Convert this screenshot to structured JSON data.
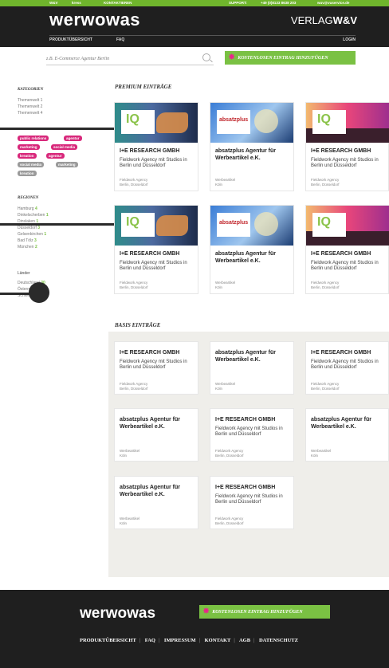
{
  "topbar": {
    "logo": "W&V",
    "partner": "kress",
    "contact": "KONTAKTIEREN",
    "support_label": "SUPPORT:",
    "phone": "+49 (0)8133 8638 203",
    "email": "wuv@vuservice.de"
  },
  "header": {
    "brand": "werwowas",
    "verlag_prefix": "VERLAG",
    "verlag_suffix": "W&V",
    "nav": [
      "PRODUKTÜBERSICHT",
      "FAQ"
    ],
    "login": "LOGIN"
  },
  "search": {
    "placeholder": "z.B. E-Commerce Agentur Berlin",
    "cta_label": "KOSTENLOSEN EINTRAG HINZUFÜGEN"
  },
  "sidebar": {
    "categories_heading": "KATEGORIEN",
    "categories": [
      "Themenwelt 1",
      "Themenwelt 2",
      "Themenwelt 4"
    ],
    "tags": [
      {
        "label": "public relations",
        "style": "pink"
      },
      {
        "label": "agentur",
        "style": "pink"
      },
      {
        "label": "marketing",
        "style": "pink"
      },
      {
        "label": "social media",
        "style": "pink"
      },
      {
        "label": "kreation",
        "style": "pink"
      },
      {
        "label": "agentur",
        "style": "pink"
      },
      {
        "label": "social media",
        "style": "grey"
      },
      {
        "label": "marketing",
        "style": "grey"
      },
      {
        "label": "kreation",
        "style": "grey"
      }
    ],
    "regions_heading": "REGIONEN",
    "regions": [
      {
        "name": "Hamburg",
        "count": "4"
      },
      {
        "name": "Dinkelscherben",
        "count": "1"
      },
      {
        "name": "Dinslaken",
        "count": "1"
      },
      {
        "name": "Düsseldorf",
        "count": "3"
      },
      {
        "name": "Gelsenkirchen",
        "count": "1"
      },
      {
        "name": "Bad Tölz",
        "count": "3"
      },
      {
        "name": "München",
        "count": "2"
      }
    ],
    "countries_heading": "Länder",
    "countries": [
      {
        "name": "Deutschland",
        "count": "30"
      },
      {
        "name": "Österreich",
        "count": ""
      },
      {
        "name": "Schweiz",
        "count": ""
      }
    ]
  },
  "premium": {
    "heading": "PREMIUM EINTRÄGE",
    "cards": [
      {
        "image": "ie",
        "name": "I+E RESEARCH GMBH",
        "desc": "Fieldwork Agency mit Studios in Berlin und Düsseldorf",
        "meta1": "Fieldwork Agency",
        "meta2": "Berlin, Düsseldorf"
      },
      {
        "image": "ab",
        "name": "absatzplus Agentur für Werbeartikel e.K.",
        "desc": "",
        "meta1": "Werbeartikel",
        "meta2": "Köln"
      },
      {
        "image": "cr",
        "name": "I+E RESEARCH GMBH",
        "desc": "Fieldwork Agency mit Studios in Berlin und Düsseldorf",
        "meta1": "Fieldwork Agency",
        "meta2": "Berlin, Düsseldorf"
      },
      {
        "image": "ie",
        "name": "I+E RESEARCH GMBH",
        "desc": "Fieldwork Agency mit Studios in Berlin und Düsseldorf",
        "meta1": "Fieldwork Agency",
        "meta2": "Berlin, Düsseldorf"
      },
      {
        "image": "ab",
        "name": "absatzplus Agentur für Werbeartikel e.K.",
        "desc": "",
        "meta1": "Werbeartikel",
        "meta2": "Köln"
      },
      {
        "image": "cr",
        "name": "I+E RESEARCH GMBH",
        "desc": "Fieldwork Agency mit Studios in Berlin und Düsseldorf",
        "meta1": "Fieldwork Agency",
        "meta2": "Berlin, Düsseldorf"
      }
    ]
  },
  "basis": {
    "heading": "BASIS EINTRÄGE",
    "cards": [
      {
        "name": "I+E RESEARCH GMBH",
        "desc": "Fieldwork Agency mit Studios in Berlin und Düsseldorf",
        "meta1": "Fieldwork Agency",
        "meta2": "Berlin, Düsseldorf"
      },
      {
        "name": "absatzplus Agentur für Werbeartikel e.K.",
        "desc": "",
        "meta1": "Werbeartikel",
        "meta2": "Köln"
      },
      {
        "name": "I+E RESEARCH GMBH",
        "desc": "Fieldwork Agency mit Studios in Berlin und Düsseldorf",
        "meta1": "Fieldwork Agency",
        "meta2": "Berlin, Düsseldorf"
      },
      {
        "name": "absatzplus Agentur für Werbeartikel e.K.",
        "desc": "",
        "meta1": "Werbeartikel",
        "meta2": "Köln"
      },
      {
        "name": "I+E RESEARCH GMBH",
        "desc": "Fieldwork Agency mit Studios in Berlin und Düsseldorf",
        "meta1": "Fieldwork Agency",
        "meta2": "Berlin, Düsseldorf"
      },
      {
        "name": "absatzplus Agentur für Werbeartikel e.K.",
        "desc": "",
        "meta1": "Werbeartikel",
        "meta2": "Köln"
      },
      {
        "name": "absatzplus Agentur für Werbeartikel e.K.",
        "desc": "",
        "meta1": "Werbeartikel",
        "meta2": "Köln"
      },
      {
        "name": "I+E RESEARCH GMBH",
        "desc": "Fieldwork Agency mit Studios in Berlin und Düsseldorf",
        "meta1": "Fieldwork Agency",
        "meta2": "Berlin, Düsseldorf"
      }
    ]
  },
  "footer": {
    "brand": "werwowas",
    "cta_label": "KOSTENLOSEN EINTRAG HINZUFÜGEN",
    "nav": [
      "PRODUKTÜBERSICHT",
      "FAQ",
      "IMPRESSUM",
      "KONTAKT",
      "AGB",
      "DATENSCHUTZ"
    ]
  },
  "colors": {
    "accent_green": "#7ac143",
    "tag_pink": "#d8287b",
    "header_dark": "#1f1f1f"
  }
}
